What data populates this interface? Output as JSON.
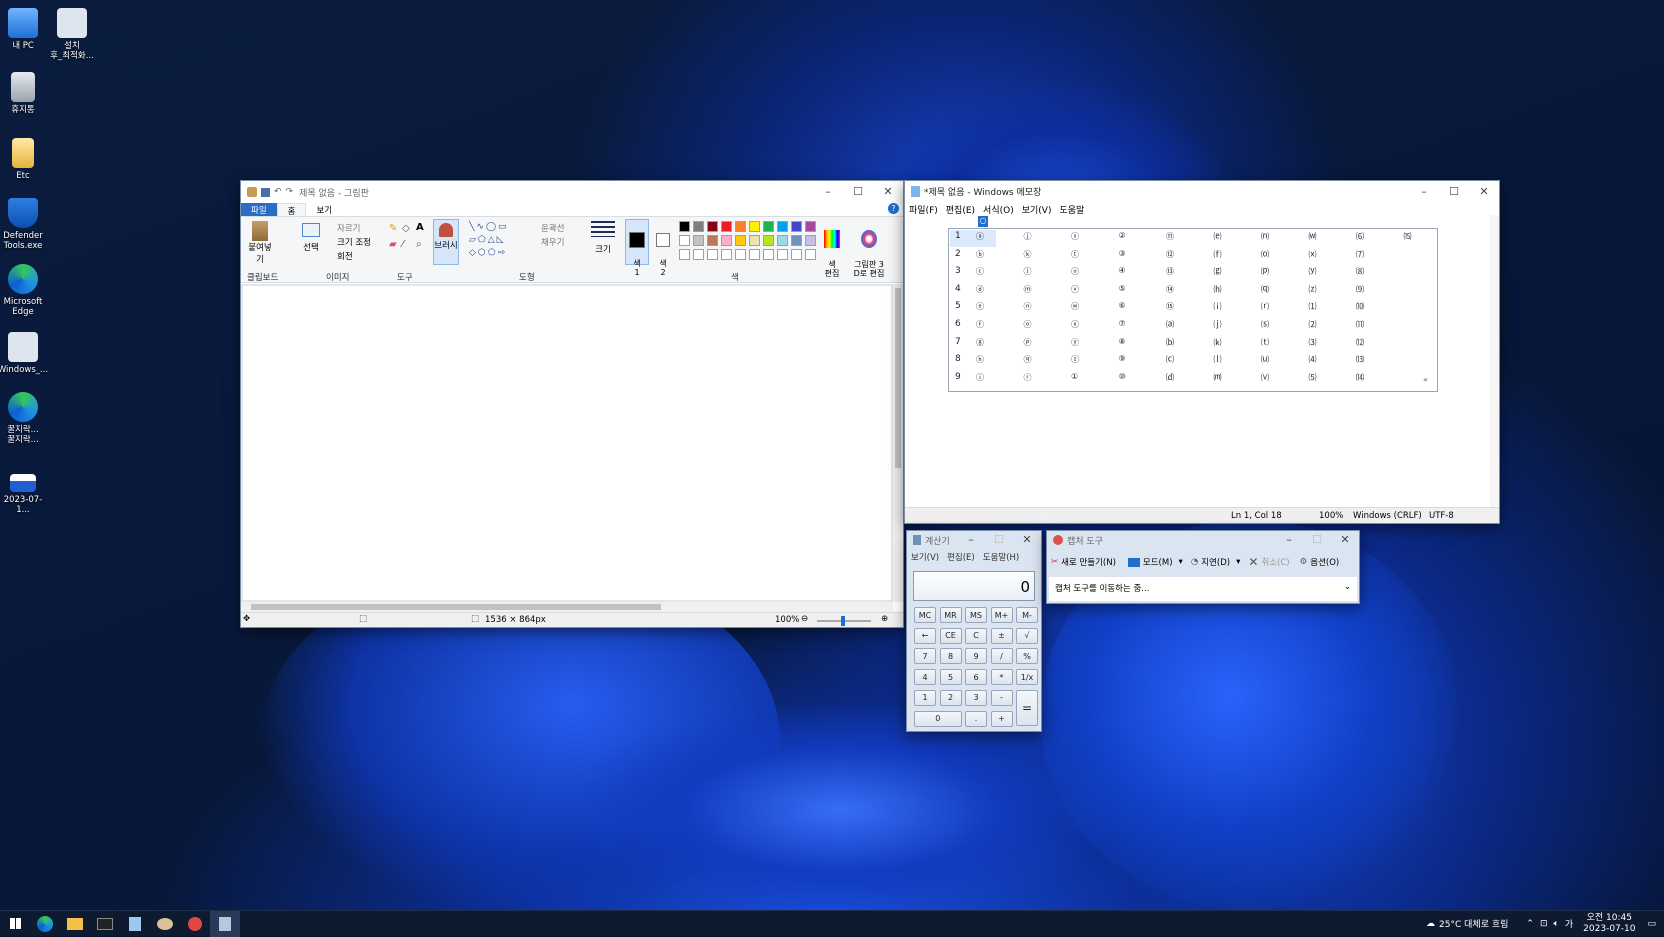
{
  "desktop": {
    "icons": [
      {
        "label": "내 PC",
        "icon": "computer-icon"
      },
      {
        "label": "설치\n후_최적화...",
        "icon": "settings-shortcut-icon"
      },
      {
        "label": "휴지통",
        "icon": "recycle-bin-icon"
      },
      {
        "label": "Etc",
        "icon": "folder-icon"
      },
      {
        "label": "Defender\nTools.exe",
        "icon": "defender-shield-icon"
      },
      {
        "label": "Microsoft\nEdge",
        "icon": "edge-icon"
      },
      {
        "label": "Windows_...",
        "icon": "settings-shortcut-icon"
      },
      {
        "label": "꿀지락...\n꿀지락...",
        "icon": "edge-icon"
      },
      {
        "label": "2023-07-1...",
        "icon": "screenshot-icon"
      }
    ]
  },
  "paint": {
    "title": "제목 없음 - 그림판",
    "tabs": [
      "파일",
      "홈",
      "보기"
    ],
    "clipboard": {
      "paste": "붙여넣기",
      "group": "클립보드"
    },
    "image": {
      "select": "선택",
      "crop": "자르기",
      "resize": "크기 조정",
      "rotate": "회전",
      "group": "이미지"
    },
    "tools_group": "도구",
    "brush": "브러시",
    "shapes": {
      "outline": "윤곽선",
      "fill": "채우기",
      "group": "도형"
    },
    "size": "크기",
    "color1": "색\n1",
    "color2": "색\n2",
    "colors_group": "색",
    "edit_colors": "색\n편집",
    "paint3d": "그림판 3\nD로 편집",
    "palette_row1": [
      "#000000",
      "#7f7f7f",
      "#880015",
      "#ed1c24",
      "#ff7f27",
      "#fff200",
      "#22b14c",
      "#00a2e8",
      "#3f48cc",
      "#a349a4"
    ],
    "palette_row2": [
      "#ffffff",
      "#c3c3c3",
      "#b97a57",
      "#ffaec9",
      "#ffc90e",
      "#efe4b0",
      "#b5e61d",
      "#99d9ea",
      "#7092be",
      "#c8bfe7"
    ],
    "status": {
      "dimensions": "1536 × 864px",
      "zoom": "100%"
    }
  },
  "notepad": {
    "title": "*제목 없음 - Windows 메모장",
    "menu": [
      "파일(F)",
      "편집(E)",
      "서식(O)",
      "보기(V)",
      "도움말"
    ],
    "popup_header": "○",
    "rows": [
      {
        "n": "1",
        "cells": [
          "ⓐ",
          "ⓙ",
          "ⓢ",
          "②",
          "⑪",
          "⒠",
          "⒩",
          "⒲",
          "⑹",
          "⒂"
        ]
      },
      {
        "n": "2",
        "cells": [
          "ⓑ",
          "ⓚ",
          "ⓣ",
          "③",
          "⑫",
          "⒡",
          "⒪",
          "⒳",
          "⑺",
          ""
        ]
      },
      {
        "n": "3",
        "cells": [
          "ⓒ",
          "ⓛ",
          "ⓤ",
          "④",
          "⑬",
          "⒢",
          "⒫",
          "⒴",
          "⑻",
          ""
        ]
      },
      {
        "n": "4",
        "cells": [
          "ⓓ",
          "ⓜ",
          "ⓥ",
          "⑤",
          "⑭",
          "⒣",
          "⒬",
          "⒵",
          "⑼",
          ""
        ]
      },
      {
        "n": "5",
        "cells": [
          "ⓔ",
          "ⓝ",
          "ⓦ",
          "⑥",
          "⑮",
          "⒤",
          "⒭",
          "⑴",
          "⑽",
          ""
        ]
      },
      {
        "n": "6",
        "cells": [
          "ⓕ",
          "ⓞ",
          "ⓧ",
          "⑦",
          "⒜",
          "⒥",
          "⒮",
          "⑵",
          "⑾",
          ""
        ]
      },
      {
        "n": "7",
        "cells": [
          "ⓖ",
          "ⓟ",
          "ⓨ",
          "⑧",
          "⒝",
          "⒦",
          "⒯",
          "⑶",
          "⑿",
          ""
        ]
      },
      {
        "n": "8",
        "cells": [
          "ⓗ",
          "ⓠ",
          "ⓩ",
          "⑨",
          "⒞",
          "⒧",
          "⒰",
          "⑷",
          "⒀",
          ""
        ]
      },
      {
        "n": "9",
        "cells": [
          "ⓘ",
          "ⓡ",
          "①",
          "⑩",
          "⒟",
          "⒨",
          "⒱",
          "⑸",
          "⒁",
          ""
        ]
      }
    ],
    "expand": "«",
    "status": {
      "position": "Ln 1, Col 18",
      "zoom": "100%",
      "eol": "Windows (CRLF)",
      "encoding": "UTF-8"
    }
  },
  "calculator": {
    "title": "계산기",
    "menu": [
      "보기(V)",
      "편집(E)",
      "도움말(H)"
    ],
    "display": "0",
    "memory": [
      "MC",
      "MR",
      "MS",
      "M+",
      "M-"
    ],
    "row2": [
      "←",
      "CE",
      "C",
      "±",
      "√"
    ],
    "row3": [
      "7",
      "8",
      "9",
      "/",
      "%"
    ],
    "row4": [
      "4",
      "5",
      "6",
      "*",
      "1/x"
    ],
    "row5": [
      "1",
      "2",
      "3",
      "-"
    ],
    "row6": [
      "0",
      ".",
      "+"
    ],
    "equals": "="
  },
  "snipping": {
    "title": "캡처 도구",
    "new": "새로 만들기(N)",
    "mode": "모드(M)",
    "delay": "지연(D)",
    "cancel": "취소(C)",
    "options": "옵션(O)",
    "message": "캡처 도구를 이동하는 중..."
  },
  "taskbar": {
    "weather": "25°C  대체로 흐림",
    "time": "오전 10:45",
    "date": "2023-07-10",
    "ime": "가"
  }
}
